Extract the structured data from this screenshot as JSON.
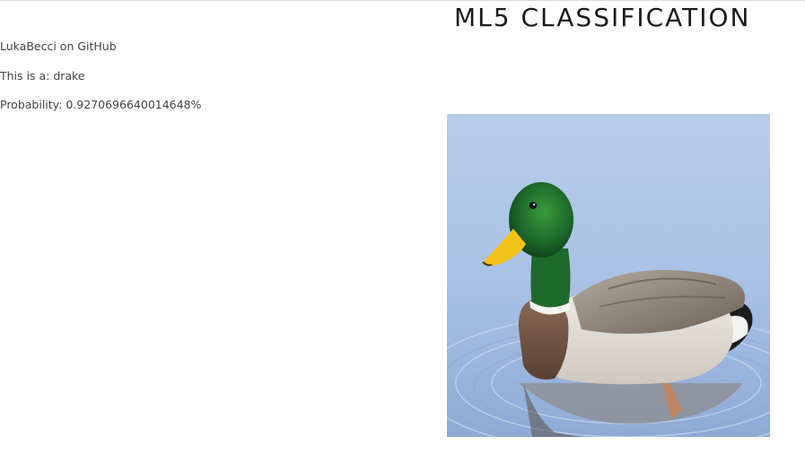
{
  "header": {
    "title": "ML5 CLASSIFICATION"
  },
  "info": {
    "author_link": "LukaBecci on GitHub",
    "label_prefix": "This is a: ",
    "label_value": "drake",
    "probability_prefix": "Probability: ",
    "probability_value": "0.9270696640014648%"
  },
  "image": {
    "subject": "mallard-drake-duck",
    "colors": {
      "sky_water": "#a9c4e6",
      "water_dark": "#7f9ccb",
      "head_green": "#1f6b2c",
      "beak_yellow": "#f2c21b",
      "breast_brown": "#6e4e3c",
      "body_light": "#e8e4de",
      "wing_gray": "#8a7e74",
      "neck_ring": "#f4f4f4"
    }
  }
}
